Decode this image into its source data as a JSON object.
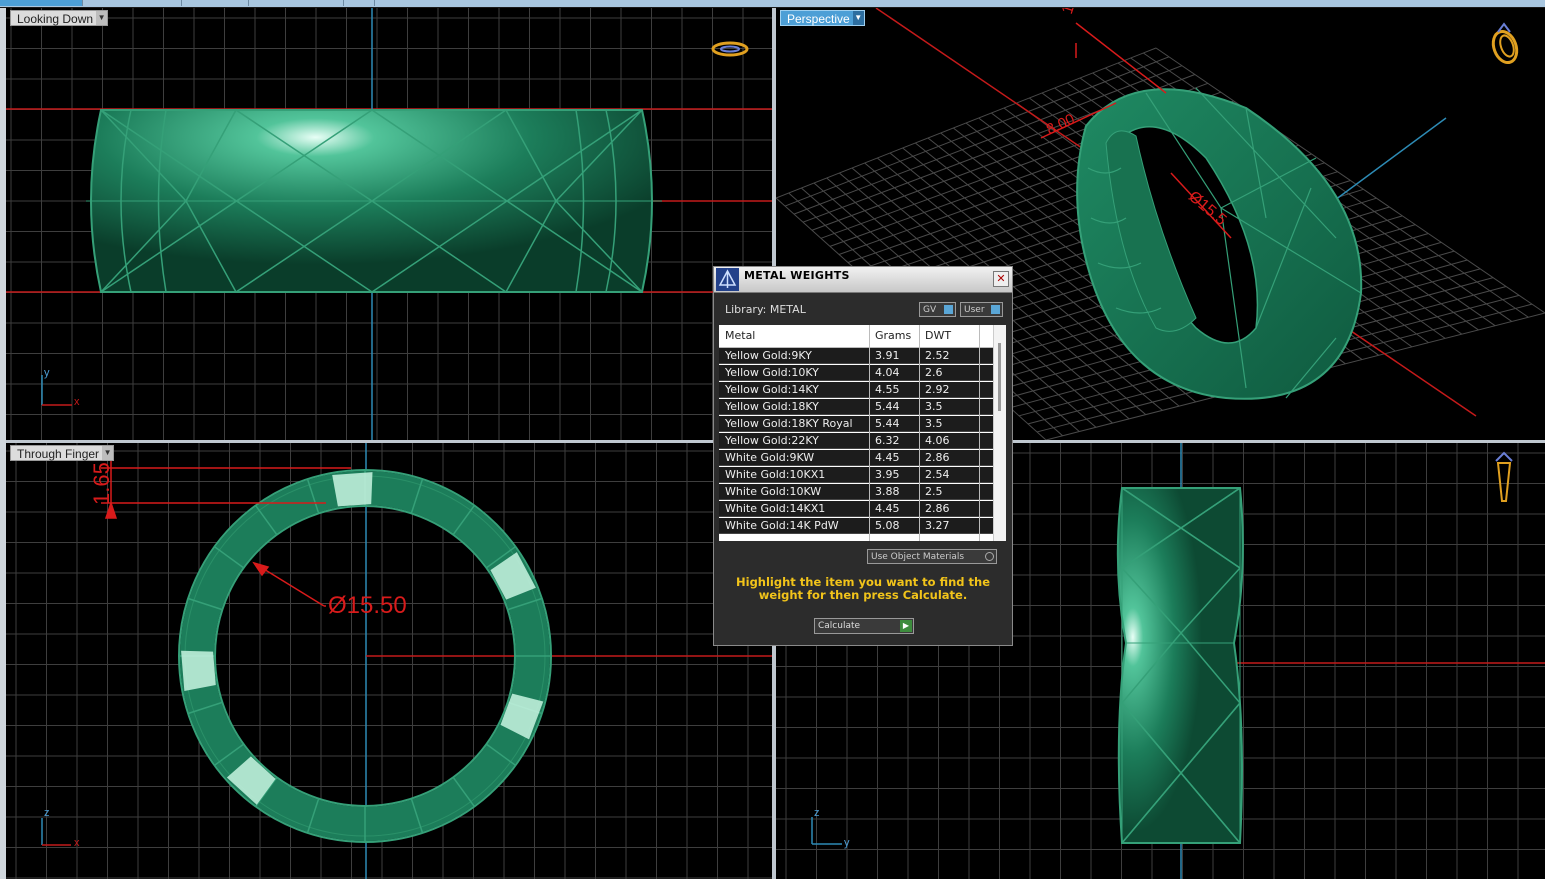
{
  "viewports": {
    "top_left_label": "Looking Down",
    "bottom_left_label": "Through Finger",
    "top_right_label": "Perspective"
  },
  "annotations": {
    "diameter": "Ø15.50",
    "thickness": "1.65",
    "persp_thickness": "1.6",
    "persp_width": "8.00",
    "persp_diameter": "Ø15.5"
  },
  "axes": {
    "tl": [
      "y",
      "x"
    ],
    "bl": [
      "z",
      "x"
    ],
    "br": [
      "z",
      "y"
    ]
  },
  "dialog": {
    "title": "METAL WEIGHTS",
    "library": "Library: METAL",
    "toggle_gv": "GV",
    "toggle_user": "User",
    "columns": [
      "Metal",
      "Grams",
      "DWT"
    ],
    "rows": [
      {
        "metal": "Yellow Gold:9KY",
        "grams": "3.91",
        "dwt": "2.52"
      },
      {
        "metal": "Yellow Gold:10KY",
        "grams": "4.04",
        "dwt": "2.6"
      },
      {
        "metal": "Yellow Gold:14KY",
        "grams": "4.55",
        "dwt": "2.92"
      },
      {
        "metal": "Yellow Gold:18KY",
        "grams": "5.44",
        "dwt": "3.5"
      },
      {
        "metal": "Yellow Gold:18KY Royal",
        "grams": "5.44",
        "dwt": "3.5"
      },
      {
        "metal": "Yellow Gold:22KY",
        "grams": "6.32",
        "dwt": "4.06"
      },
      {
        "metal": "White Gold:9KW",
        "grams": "4.45",
        "dwt": "2.86"
      },
      {
        "metal": "White Gold:10KX1",
        "grams": "3.95",
        "dwt": "2.54"
      },
      {
        "metal": "White Gold:10KW",
        "grams": "3.88",
        "dwt": "2.5"
      },
      {
        "metal": "White Gold:14KX1",
        "grams": "4.45",
        "dwt": "2.86"
      },
      {
        "metal": "White Gold:14K PdW",
        "grams": "5.08",
        "dwt": "3.27"
      }
    ],
    "use_object_materials": "Use Object Materials",
    "hint": "Highlight the item you want to find the weight for then press Calculate.",
    "calculate": "Calculate"
  },
  "colors": {
    "ring": "#1c7d5a",
    "ring_line": "#35a078",
    "grid": "#3e3e3e",
    "axis_red": "#c41a1a",
    "axis_blue": "#2d8bb5",
    "dim_red": "#d81b1b",
    "label_blue": "#4d9fd6",
    "hint_yellow": "#f2c41a"
  }
}
